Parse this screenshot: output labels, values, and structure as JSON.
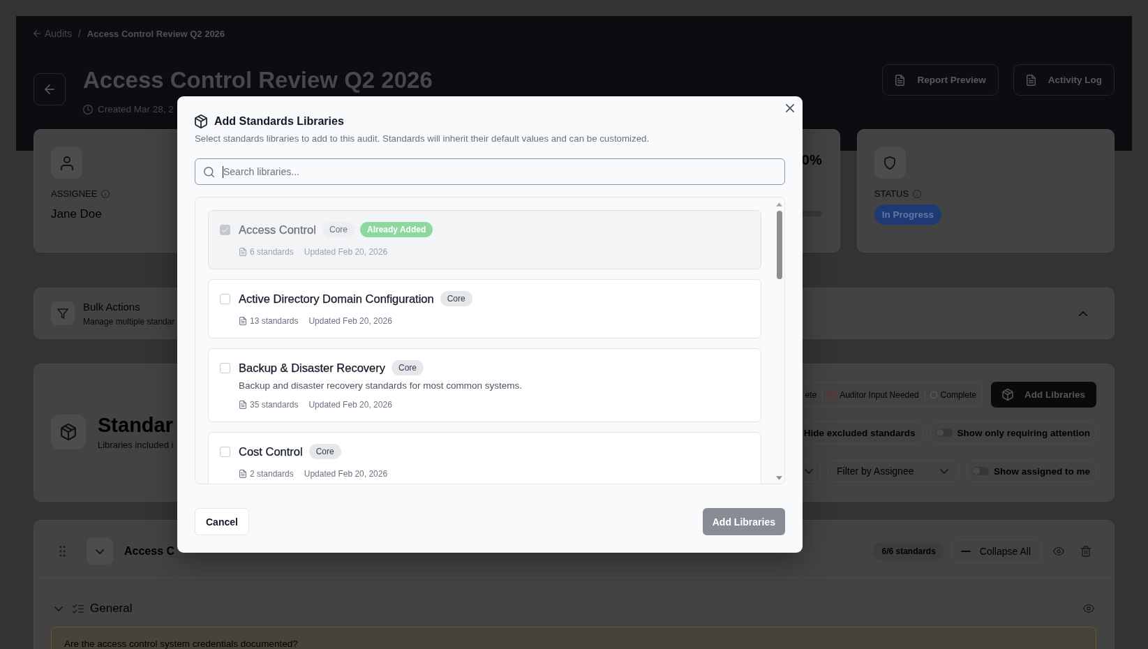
{
  "breadcrumb": {
    "back_label": "Audits",
    "separator": "/",
    "current": "Access Control Review Q2 2026"
  },
  "header": {
    "title": "Access Control Review Q2 2026",
    "created": "Created Mar 28, 2",
    "actions": [
      "Report Preview",
      "Activity Log"
    ]
  },
  "summary_cards": [
    {
      "kind": "assignee",
      "label": "ASSIGNEE",
      "value": "Jane Doe"
    },
    {
      "kind": "progress",
      "value": "0%"
    },
    {
      "kind": "status",
      "label": "STATUS",
      "value": "In Progress"
    }
  ],
  "bulk_actions": {
    "title": "Bulk Actions",
    "subtitle": "Manage multiple standar"
  },
  "standards_panel": {
    "title": "Standar",
    "subtitle": "Libraries included i",
    "legend": [
      {
        "kind": "text",
        "label": "ete"
      },
      {
        "kind": "square",
        "label": "Auditor Input Needed",
        "color": "#8a1d1d"
      },
      {
        "kind": "circle",
        "label": "Complete",
        "color": "#626262"
      }
    ],
    "add_button": "Add Libraries",
    "control_rows": [
      [
        {
          "kind": "chip",
          "label": "Hide excluded standards"
        },
        {
          "kind": "toggle",
          "label": "Show only requiring attention",
          "on": false
        }
      ],
      [
        {
          "kind": "dropdown"
        },
        {
          "kind": "dropdown",
          "label": "Filter by Assignee"
        },
        {
          "kind": "toggle",
          "label": "Show assigned to me",
          "on": false
        }
      ]
    ]
  },
  "section": {
    "title": "Access C",
    "count": "6/6 standards",
    "collapse_button": "Collapse All",
    "groups": [
      {
        "title": "General",
        "questions": [
          "Are the access control system credentials documented?"
        ]
      }
    ]
  },
  "modal": {
    "title": "Add Standards Libraries",
    "description": "Select standards libraries to add to this audit. Standards will inherit their default values and can be customized.",
    "search": {
      "placeholder": "Search libraries..."
    },
    "libraries": [
      {
        "name": "Access Control",
        "tag": "Core",
        "status_badge": "Already Added",
        "checked": true,
        "disabled": true,
        "count": "6 standards",
        "updated": "Updated Feb 20, 2026"
      },
      {
        "name": "Active Directory Domain Configuration",
        "tag": "Core",
        "checked": false,
        "disabled": false,
        "count": "13 standards",
        "updated": "Updated Feb 20, 2026"
      },
      {
        "name": "Backup & Disaster Recovery",
        "tag": "Core",
        "description": "Backup and disaster recovery standards for most common systems.",
        "checked": false,
        "disabled": false,
        "count": "35 standards",
        "updated": "Updated Feb 20, 2026"
      },
      {
        "name": "Cost Control",
        "tag": "Core",
        "checked": false,
        "disabled": false,
        "count": "2 standards",
        "updated": "Updated Feb 20, 2026"
      }
    ],
    "cancel_button": "Cancel",
    "submit_button": {
      "label": "Add Libraries",
      "disabled": true
    }
  }
}
